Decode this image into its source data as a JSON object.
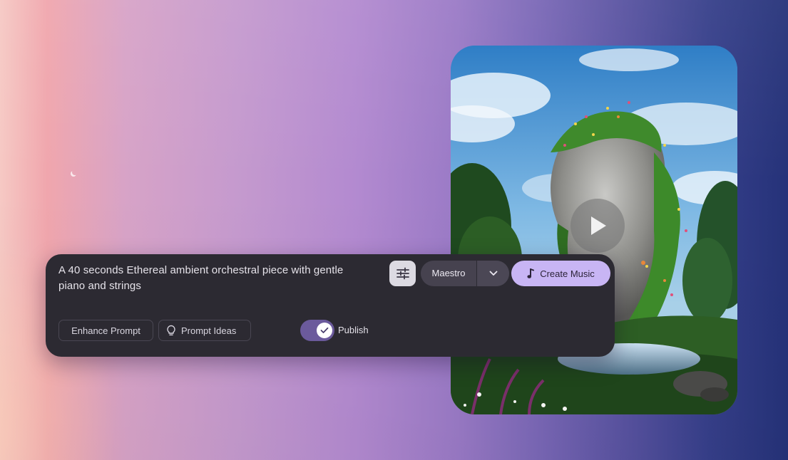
{
  "prompt": {
    "text": "A 40 seconds Ethereal ambient orchestral piece with gentle piano and strings"
  },
  "toolbar": {
    "settings_icon": "sliders-icon",
    "model": "Maestro",
    "model_dropdown_icon": "chevron-down-icon",
    "create_label": "Create Music",
    "create_icon": "music-note-icon"
  },
  "actions": {
    "enhance_label": "Enhance Prompt",
    "ideas_label": "Prompt Ideas",
    "ideas_icon": "lightbulb-icon"
  },
  "publish": {
    "label": "Publish",
    "enabled": true
  },
  "media": {
    "play_icon": "play-icon"
  },
  "colors": {
    "accent": "#c8b5f4",
    "panel": "#2c2a32",
    "toggle_on": "#6b5a9c"
  }
}
